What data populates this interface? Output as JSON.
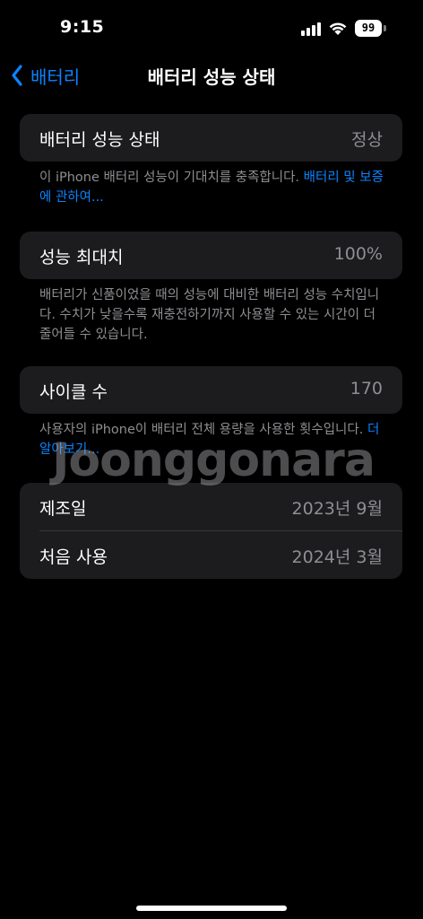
{
  "status_bar": {
    "time": "9:15",
    "battery_level": "99",
    "icons": [
      "signal-icon",
      "wifi-icon",
      "battery-icon"
    ]
  },
  "nav": {
    "back_label": "배터리",
    "title": "배터리 성능 상태",
    "back_icon": "chevron-left-icon"
  },
  "health": {
    "label": "배터리 성능 상태",
    "value": "정상",
    "footnote_text": "이 iPhone 배터리 성능이 기대치를 충족합니다. ",
    "footnote_link": "배터리 및 보증에 관하여..."
  },
  "max_capacity": {
    "label": "성능 최대치",
    "value": "100%",
    "footnote": "배터리가 신품이었을 때의 성능에 대비한 배터리 성능 수치입니다. 수치가 낮을수록 재충전하기까지 사용할 수 있는 시간이 더 줄어들 수 있습니다."
  },
  "cycle_count": {
    "label": "사이클 수",
    "value": "170",
    "footnote_text": "사용자의 iPhone이 배터리 전체 용량을 사용한 횟수입니다. ",
    "footnote_link": "더 알아보기..."
  },
  "dates": {
    "manufacture_label": "제조일",
    "manufacture_value": "2023년 9월",
    "first_use_label": "처음 사용",
    "first_use_value": "2024년 3월"
  },
  "watermark": "Joonggonara",
  "colors": {
    "background": "#000000",
    "card": "#1c1c1e",
    "accent": "#0a84ff",
    "secondary_text": "#8e8e93"
  }
}
